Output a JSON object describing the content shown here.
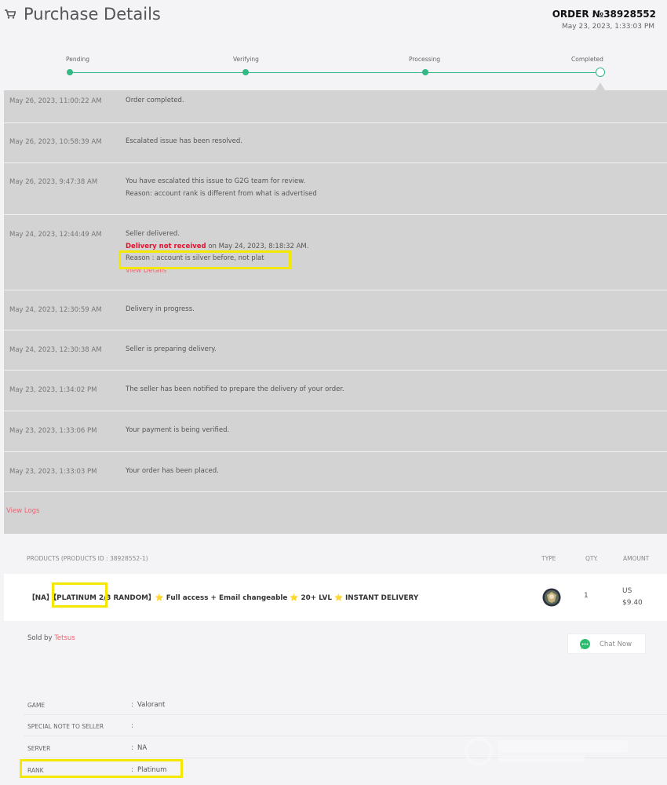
{
  "header": {
    "title": "Purchase Details",
    "order_number": "ORDER №38928552",
    "order_date": "May 23, 2023, 1:33:03 PM"
  },
  "progress": {
    "steps": [
      "Pending",
      "Verifying",
      "Processing",
      "Completed"
    ],
    "current_step": "Completed",
    "accent_color": "#33b886"
  },
  "logs": [
    {
      "time": "May 26, 2023, 11:00:22 AM",
      "message": "Order completed."
    },
    {
      "time": "May 26, 2023, 10:58:39 AM",
      "message": "Escalated issue has been resolved."
    },
    {
      "time": "May 26, 2023, 9:47:38 AM",
      "line1": "You have escalated this issue to G2G team for review.",
      "line2": "Reason: account rank is different from what is advertised"
    },
    {
      "time": "May 24, 2023, 12:44:49 AM",
      "line1": "Seller delivered.",
      "status_red": "Delivery not received",
      "status_rest": " on May 24, 2023, 8:18:32 AM.",
      "reason": "Reason : account is silver before, not plat",
      "link": "View Details"
    },
    {
      "time": "May 24, 2023, 12:30:59 AM",
      "message": "Delivery in progress."
    },
    {
      "time": "May 24, 2023, 12:30:38 AM",
      "message": "Seller is preparing delivery."
    },
    {
      "time": "May 23, 2023, 1:34:02 PM",
      "message": "The seller has been notified to prepare the delivery of your order."
    },
    {
      "time": "May 23, 2023, 1:33:06 PM",
      "message": "Your payment is being verified."
    },
    {
      "time": "May 23, 2023, 1:33:03 PM",
      "message": "Your order has been placed."
    }
  ],
  "view_logs_label": "View Logs",
  "products": {
    "headers": {
      "products": "PRODUCTS (PRODUCTS ID : 38928552-1)",
      "type": "TYPE",
      "qty": "QTY.",
      "amount": "AMOUNT"
    },
    "item": {
      "title_a": "【NA】",
      "title_b": "【PLATINUM",
      "title_c": " 2/3 RANDOM】",
      "title_d": " Full access + Email changeable ",
      "title_e": " 20+ LVL ",
      "title_f": " INSTANT DELIVERY",
      "star": "⭐",
      "qty": "1",
      "currency": "US",
      "amount": "$9.40"
    }
  },
  "seller": {
    "sold_by_label": "Sold by ",
    "name": "Tetsus",
    "chat_label": "Chat Now"
  },
  "info": [
    {
      "label": "GAME",
      "value": "Valorant"
    },
    {
      "label": "SPECIAL NOTE TO SELLER",
      "value": ""
    },
    {
      "label": "SERVER",
      "value": "NA"
    },
    {
      "label": "RANK",
      "value": "Platinum"
    }
  ],
  "info_colon": ":",
  "colors": {
    "panel": "#d3d3d3",
    "link": "#f06372",
    "alert": "#e8112d",
    "highlight": "#f5e800"
  }
}
